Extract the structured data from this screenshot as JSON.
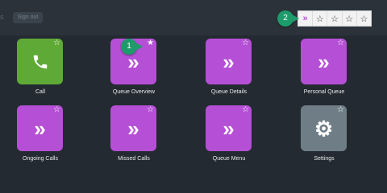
{
  "topbar": {
    "edge_glyph": "s",
    "button_label": "Sign out"
  },
  "favorites_bar": {
    "slots": [
      {
        "kind": "chevron",
        "glyph": "»"
      },
      {
        "kind": "empty",
        "glyph": "☆"
      },
      {
        "kind": "empty",
        "glyph": "☆"
      },
      {
        "kind": "empty",
        "glyph": "☆"
      },
      {
        "kind": "empty",
        "glyph": "☆"
      }
    ]
  },
  "markers": {
    "one": "1",
    "two": "2"
  },
  "tiles": [
    {
      "label": "Call",
      "color": "#5fa936",
      "icon": "phone-icon",
      "glyph": "✆",
      "favorited": false,
      "star": "☆"
    },
    {
      "label": "Queue Overview",
      "color": "#b54fd6",
      "icon": "double-chevron-icon",
      "glyph": "»",
      "favorited": true,
      "star": "★"
    },
    {
      "label": "Queue Details",
      "color": "#b54fd6",
      "icon": "double-chevron-icon",
      "glyph": "»",
      "favorited": false,
      "star": "☆"
    },
    {
      "label": "Personal Queue",
      "color": "#b54fd6",
      "icon": "double-chevron-icon",
      "glyph": "»",
      "favorited": false,
      "star": "☆"
    },
    {
      "label": "Ongoing Calls",
      "color": "#b54fd6",
      "icon": "double-chevron-icon",
      "glyph": "»",
      "favorited": false,
      "star": "☆"
    },
    {
      "label": "Missed Calls",
      "color": "#b54fd6",
      "icon": "double-chevron-icon",
      "glyph": "»",
      "favorited": false,
      "star": "☆"
    },
    {
      "label": "Queue Menu",
      "color": "#b54fd6",
      "icon": "double-chevron-icon",
      "glyph": "»",
      "favorited": false,
      "star": "☆"
    },
    {
      "label": "Settings",
      "color": "#6f7e86",
      "icon": "gear-icon",
      "glyph": "⚙",
      "favorited": false,
      "star": "☆"
    }
  ]
}
